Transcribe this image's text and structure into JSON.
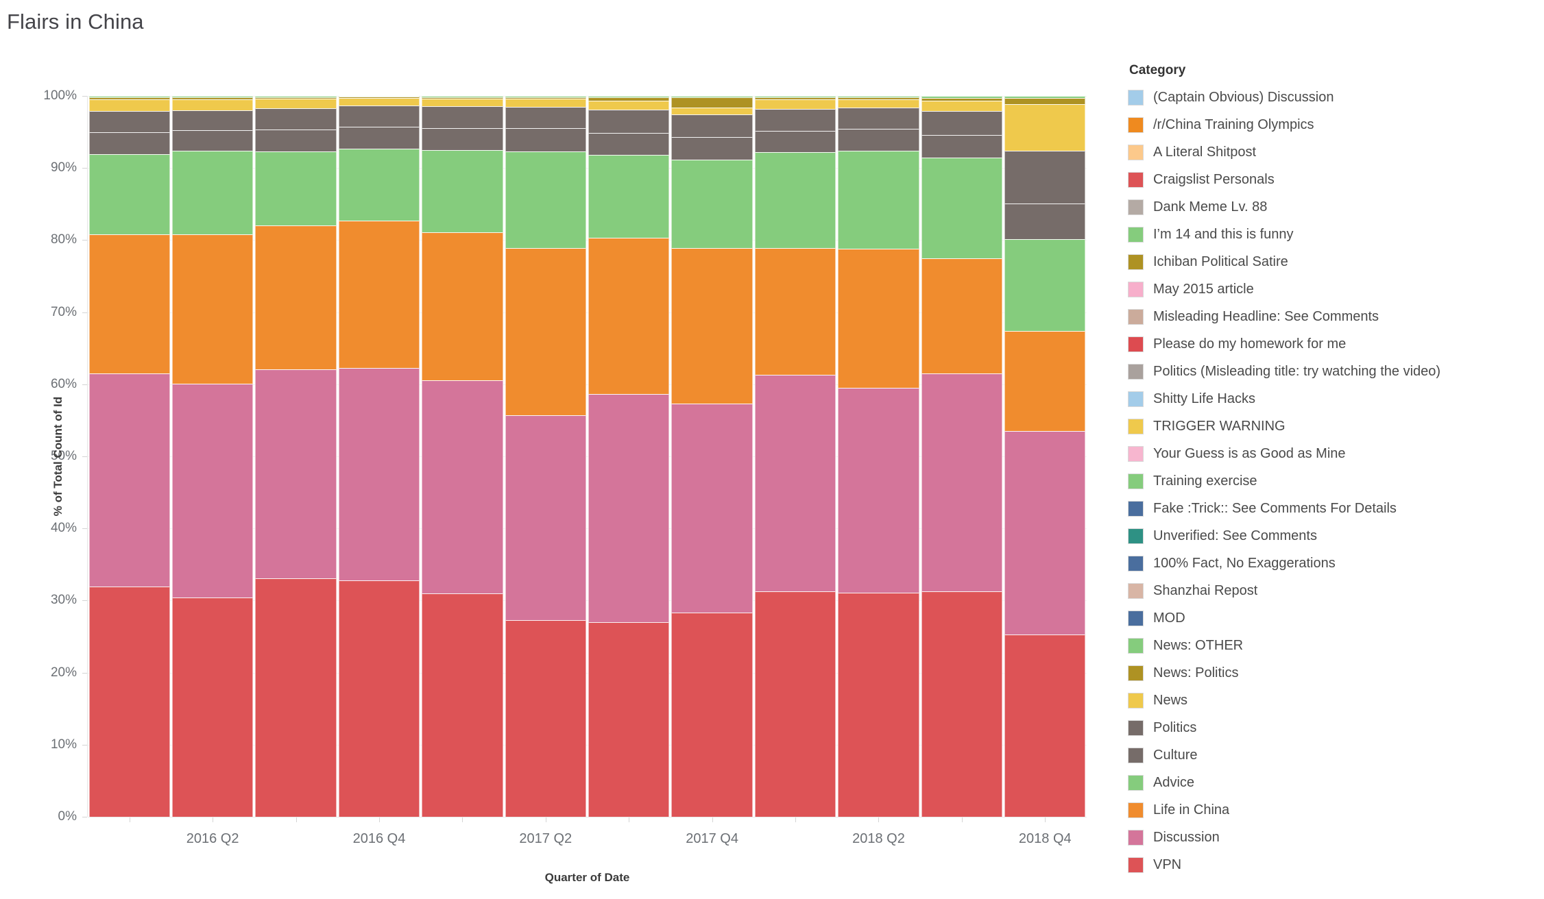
{
  "title": "Flairs in China",
  "legend": {
    "title": "Category",
    "items": [
      {
        "label": "(Captain Obvious) Discussion",
        "color": "#A3CCE9"
      },
      {
        "label": "/r/China Training Olympics",
        "color": "#EF8A1F"
      },
      {
        "label": "A Literal Shitpost",
        "color": "#FCC98B"
      },
      {
        "label": "Craigslist Personals",
        "color": "#DD5356"
      },
      {
        "label": "Dank Meme Lv. 88",
        "color": "#B4AAA4"
      },
      {
        "label": "I’m 14 and this is funny",
        "color": "#85CC7D"
      },
      {
        "label": "Ichiban Political Satire",
        "color": "#AE9223"
      },
      {
        "label": "May 2015 article",
        "color": "#F7AFCB"
      },
      {
        "label": "Misleading Headline: See Comments",
        "color": "#CBAB9B"
      },
      {
        "label": "Please do my homework for me",
        "color": "#DD4B50"
      },
      {
        "label": "Politics (Misleading title: try watching the video)",
        "color": "#A9A19D"
      },
      {
        "label": "Shitty Life Hacks",
        "color": "#A3CCE9"
      },
      {
        "label": "TRIGGER WARNING",
        "color": "#EFC94C"
      },
      {
        "label": "Your Guess is as Good as Mine",
        "color": "#F7B6CF"
      },
      {
        "label": "Training exercise",
        "color": "#85CC7D"
      },
      {
        "label": "Fake :Trick:: See Comments For Details",
        "color": "#4A6E9E"
      },
      {
        "label": "Unverified: See Comments",
        "color": "#2E9184"
      },
      {
        "label": "100% Fact, No Exaggerations",
        "color": "#4A6E9E"
      },
      {
        "label": "Shanzhai Repost",
        "color": "#D8B5A5"
      },
      {
        "label": "MOD",
        "color": "#4A6E9E"
      },
      {
        "label": "News: OTHER",
        "color": "#85CC7D"
      },
      {
        "label": "News: Politics",
        "color": "#AE9223"
      },
      {
        "label": "News",
        "color": "#EFC94C"
      },
      {
        "label": "Politics",
        "color": "#766C69"
      },
      {
        "label": "Culture",
        "color": "#766C69"
      },
      {
        "label": "Advice",
        "color": "#85CC7D"
      },
      {
        "label": "Life in China",
        "color": "#F08C2E"
      },
      {
        "label": "Discussion",
        "color": "#D4759A"
      },
      {
        "label": "VPN",
        "color": "#DD5356"
      }
    ]
  },
  "chart_data": {
    "type": "bar",
    "subtype": "stacked-percent",
    "title": "Flairs in China",
    "xlabel": "Quarter of Date",
    "ylabel": "% of Total Count of Id",
    "ylim": [
      0,
      100
    ],
    "ytick_labels": [
      "0%",
      "10%",
      "20%",
      "30%",
      "40%",
      "50%",
      "60%",
      "70%",
      "80%",
      "90%",
      "100%"
    ],
    "ytick_values": [
      0,
      10,
      20,
      30,
      40,
      50,
      60,
      70,
      80,
      90,
      100
    ],
    "grid": true,
    "legend_position": "right",
    "categories": [
      "2016 Q1",
      "2016 Q2",
      "2016 Q3",
      "2016 Q4",
      "2017 Q1",
      "2017 Q2",
      "2017 Q3",
      "2017 Q4",
      "2018 Q1",
      "2018 Q2",
      "2018 Q3",
      "2018 Q4"
    ],
    "xtick_labels_shown": [
      "2016 Q2",
      "2016 Q4",
      "2017 Q2",
      "2017 Q4",
      "2018 Q2",
      "2018 Q4"
    ],
    "series": [
      {
        "name": "VPN",
        "color": "#DD5356",
        "values": [
          31.9,
          30.7,
          33.1,
          32.8,
          31.0,
          27.3,
          26.7,
          28.3,
          31.3,
          31.1,
          30.8,
          25.3
        ]
      },
      {
        "name": "Discussion",
        "color": "#D4759A",
        "values": [
          29.6,
          29.9,
          29.0,
          29.5,
          29.6,
          28.4,
          31.4,
          29.0,
          30.0,
          28.4,
          29.8,
          28.2
        ]
      },
      {
        "name": "Life in China",
        "color": "#F08C2E",
        "values": [
          19.3,
          20.9,
          19.9,
          20.4,
          20.5,
          23.2,
          21.4,
          21.6,
          17.6,
          19.3,
          15.8,
          13.9
        ]
      },
      {
        "name": "Advice",
        "color": "#85CC7D",
        "values": [
          11.1,
          11.7,
          10.3,
          10.0,
          11.4,
          13.4,
          11.4,
          12.3,
          13.3,
          13.6,
          13.8,
          12.7
        ]
      },
      {
        "name": "Culture",
        "color": "#766C69",
        "values": [
          3.1,
          2.9,
          3.0,
          3.0,
          3.0,
          3.2,
          3.0,
          3.1,
          3.0,
          3.0,
          3.1,
          5.0
        ]
      },
      {
        "name": "Politics",
        "color": "#766C69",
        "values": [
          2.9,
          2.8,
          3.0,
          3.0,
          3.1,
          3.0,
          3.2,
          3.1,
          3.0,
          3.0,
          3.2,
          7.3
        ]
      },
      {
        "name": "News",
        "color": "#EFC94C",
        "values": [
          1.6,
          1.5,
          1.3,
          1.0,
          1.0,
          1.1,
          1.2,
          1.0,
          1.3,
          1.1,
          1.4,
          6.5
        ]
      },
      {
        "name": "News: Politics",
        "color": "#AE9223",
        "values": [
          0.3,
          0.3,
          0.2,
          0.2,
          0.2,
          0.2,
          0.5,
          1.4,
          0.3,
          0.3,
          0.4,
          0.8
        ]
      },
      {
        "name": "News: OTHER",
        "color": "#85CC7D",
        "values": [
          0.2,
          0.2,
          0.2,
          0.1,
          0.2,
          0.2,
          0.2,
          0.2,
          0.2,
          0.2,
          0.3,
          0.3
        ]
      }
    ]
  }
}
